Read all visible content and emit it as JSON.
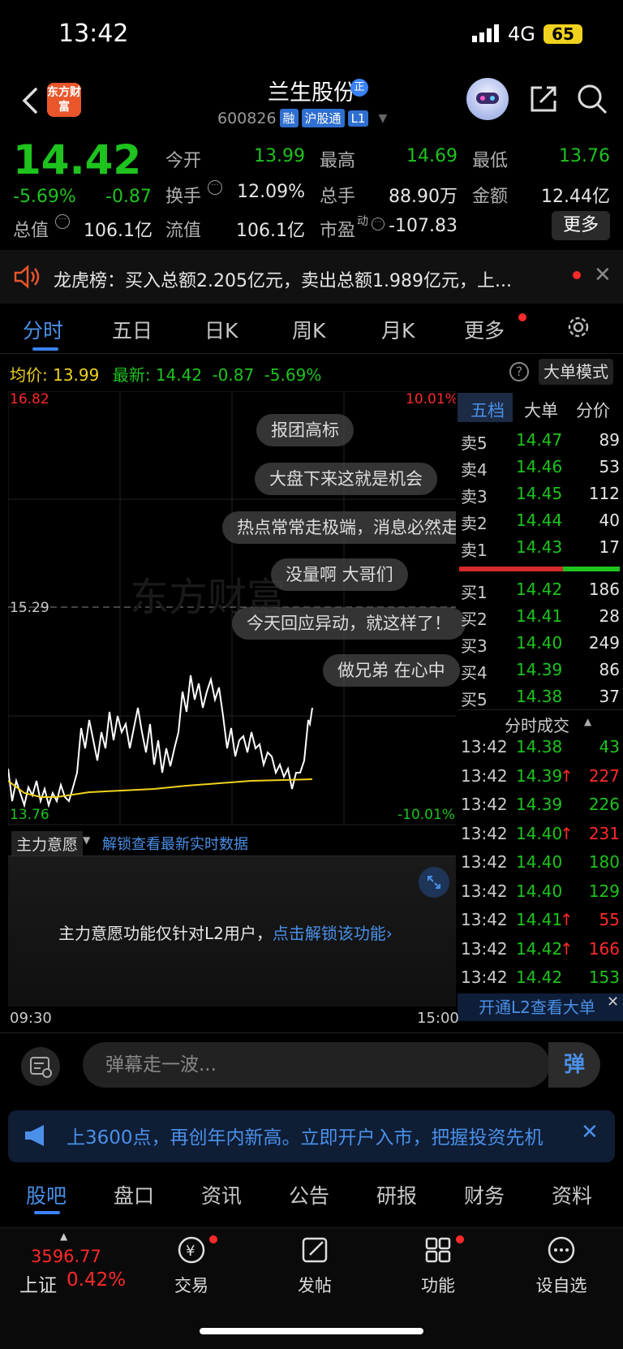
{
  "status": {
    "time": "13:42",
    "network": "4G",
    "battery": "65"
  },
  "header": {
    "logo": "东方财富",
    "name": "兰生股份",
    "badge": "正",
    "code": "600826",
    "tags": [
      "融",
      "沪股通",
      "L1"
    ]
  },
  "quote": {
    "price": "14.42",
    "pct": "-5.69%",
    "chg": "-0.87",
    "fields": [
      {
        "label": "今开",
        "value": "13.99",
        "color": "green"
      },
      {
        "label": "最高",
        "value": "14.69",
        "color": "green"
      },
      {
        "label": "最低",
        "value": "13.76",
        "color": "green"
      },
      {
        "label": "换手",
        "value": "12.09%",
        "color": "white"
      },
      {
        "label": "总手",
        "value": "88.90万",
        "color": "white"
      },
      {
        "label": "金额",
        "value": "12.44亿",
        "color": "white"
      },
      {
        "label": "总值",
        "value": "106.1亿",
        "color": "white"
      },
      {
        "label": "流值",
        "value": "106.1亿",
        "color": "white"
      },
      {
        "label": "市盈",
        "value": "-107.83",
        "color": "white"
      }
    ],
    "pe_sup": "动",
    "more": "更多"
  },
  "dragon": {
    "text": "龙虎榜：买入总额2.205亿元，卖出总额1.989亿元，上..."
  },
  "chart_tabs": [
    "分时",
    "五日",
    "日K",
    "周K",
    "月K",
    "更多"
  ],
  "avg": {
    "label": "均价:",
    "value": "13.99",
    "latest_label": "最新:",
    "latest": "14.42",
    "chg": "-0.87",
    "pct": "-5.69%"
  },
  "big_order_mode": "大单模式",
  "chart_labels": {
    "top_left": "16.82",
    "top_right": "10.01%",
    "mid_left": "15.29",
    "bot_right": "-10.01%",
    "bot_left": "13.76"
  },
  "danmu": [
    "报团高标",
    "大盘下来这就是机会",
    "热点常常走极端，消息必然走",
    "没量啊  大哥们",
    "今天回应异动，就这样了！",
    "做兄弟 在心中"
  ],
  "book": {
    "tabs": [
      "五档",
      "大单",
      "分价"
    ],
    "sells": [
      {
        "label": "卖5",
        "price": "14.47",
        "vol": "89"
      },
      {
        "label": "卖4",
        "price": "14.46",
        "vol": "53"
      },
      {
        "label": "卖3",
        "price": "14.45",
        "vol": "112"
      },
      {
        "label": "卖2",
        "price": "14.44",
        "vol": "40"
      },
      {
        "label": "卖1",
        "price": "14.43",
        "vol": "17"
      }
    ],
    "buys": [
      {
        "label": "买1",
        "price": "14.42",
        "vol": "186"
      },
      {
        "label": "买2",
        "price": "14.41",
        "vol": "28"
      },
      {
        "label": "买3",
        "price": "14.40",
        "vol": "249"
      },
      {
        "label": "买4",
        "price": "14.39",
        "vol": "86"
      },
      {
        "label": "买5",
        "price": "14.38",
        "vol": "37"
      }
    ],
    "ticks_title": "分时成交",
    "ticks": [
      {
        "t": "13:42",
        "p": "14.38",
        "up": false,
        "v": "43"
      },
      {
        "t": "13:42",
        "p": "14.39",
        "up": true,
        "v": "227"
      },
      {
        "t": "13:42",
        "p": "14.39",
        "up": false,
        "v": "226"
      },
      {
        "t": "13:42",
        "p": "14.40",
        "up": true,
        "v": "231"
      },
      {
        "t": "13:42",
        "p": "14.40",
        "up": false,
        "v": "180"
      },
      {
        "t": "13:42",
        "p": "14.40",
        "up": false,
        "v": "129"
      },
      {
        "t": "13:42",
        "p": "14.41",
        "up": true,
        "v": "55"
      },
      {
        "t": "13:42",
        "p": "14.42",
        "up": true,
        "v": "166"
      },
      {
        "t": "13:42",
        "p": "14.42",
        "up": false,
        "v": "153"
      }
    ],
    "l2": "开通L2查看大单"
  },
  "intent": {
    "title": "主力意愿",
    "unlock": "解锁查看最新实时数据",
    "msg": "主力意愿功能仅针对L2用户，",
    "link": "点击解锁该功能"
  },
  "times": {
    "start": "09:30",
    "end": "15:00"
  },
  "danmu_input": {
    "placeholder": "弹幕走一波...",
    "send": "弹"
  },
  "ad": {
    "text": "上3600点，再创年内新高。立即开户入市，把握投资先机"
  },
  "sec_tabs": [
    "股吧",
    "盘口",
    "资讯",
    "公告",
    "研报",
    "财务",
    "资料"
  ],
  "tabbar": {
    "index_value": "3596.77",
    "index_name": "上证",
    "index_pct": "0.42%",
    "items": [
      "交易",
      "发帖",
      "功能",
      "设自选"
    ]
  }
}
